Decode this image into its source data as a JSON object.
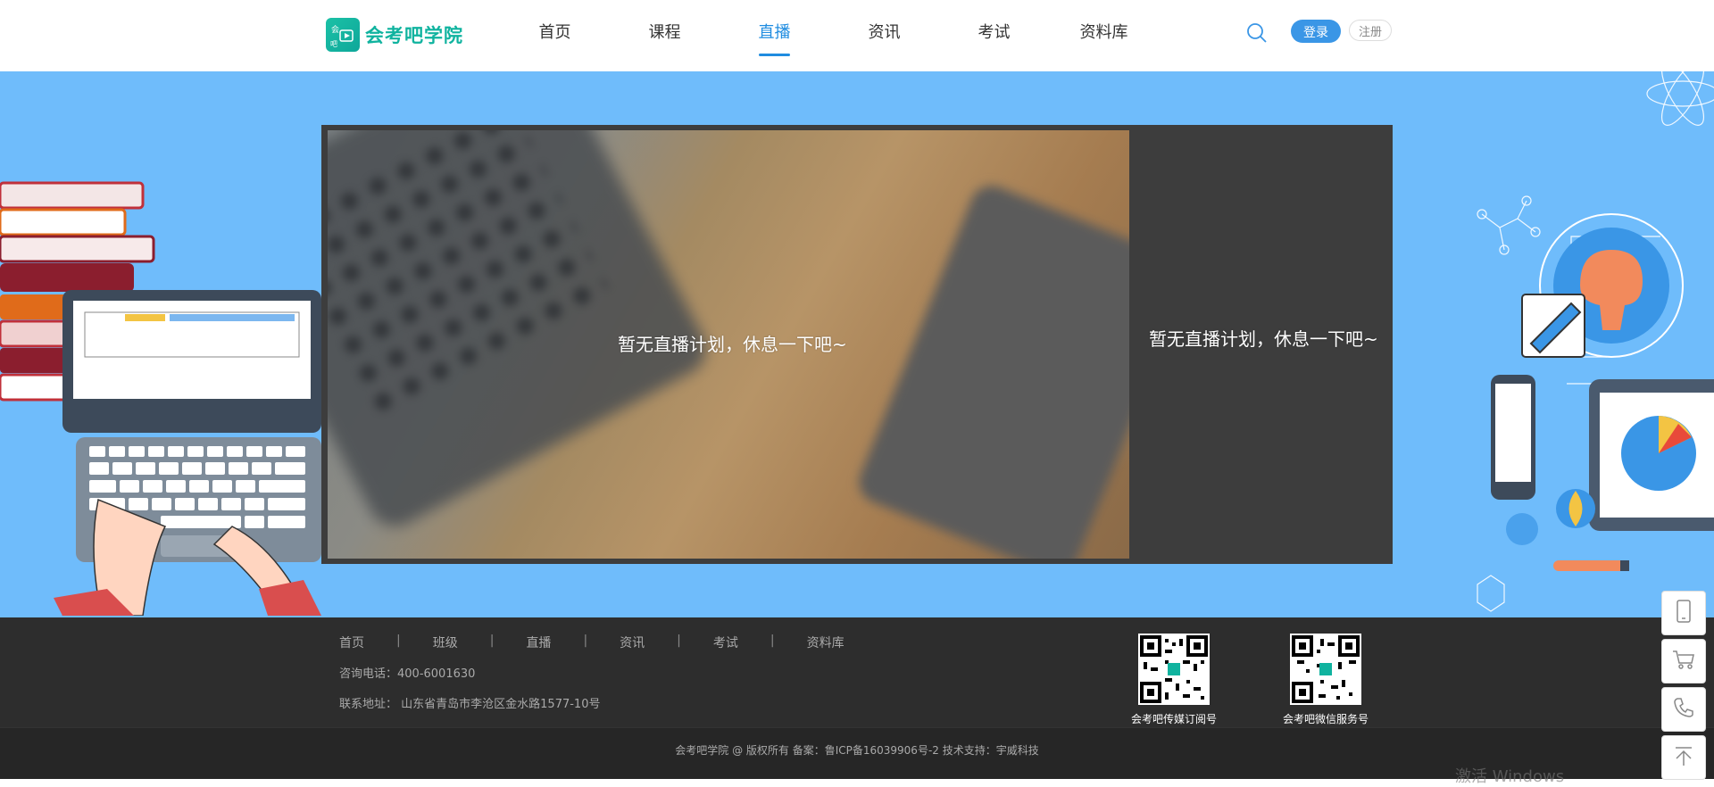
{
  "header": {
    "logo_text": "会考吧学院",
    "nav": [
      "首页",
      "课程",
      "直播",
      "资讯",
      "考试",
      "资料库"
    ],
    "active_nav": "直播",
    "login_label": "登录",
    "register_label": "注册"
  },
  "live": {
    "main_message": "暂无直播计划，休息一下吧~",
    "side_message": "暂无直播计划，休息一下吧~"
  },
  "footer": {
    "nav": [
      "首页",
      "班级",
      "直播",
      "资讯",
      "考试",
      "资料库"
    ],
    "phone_label": "咨询电话：",
    "phone": "400-6001630",
    "address_label": "联系地址：",
    "address": "山东省青岛市李沧区金水路1577-10号",
    "qr_codes": [
      {
        "caption": "会考吧传媒订阅号"
      },
      {
        "caption": "会考吧微信服务号"
      }
    ],
    "copyright": "会考吧学院 @ 版权所有   备案：鲁ICP备16039906号-2   技术支持：宇威科技"
  },
  "watermark": "激活 Windows",
  "colors": {
    "accent": "#1f8ce0",
    "brand": "#10b39f",
    "banner_bg": "#6fbcfb",
    "footer_bg": "#2d2d2d"
  },
  "side_tools": [
    "phone-icon",
    "cart-icon",
    "call-icon",
    "back-to-top-icon"
  ]
}
